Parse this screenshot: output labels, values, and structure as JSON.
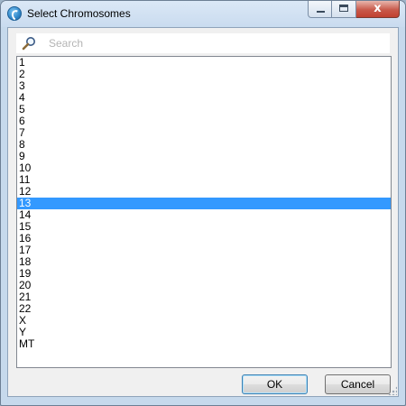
{
  "window": {
    "title": "Select Chromosomes",
    "minimize_glyph": "",
    "maximize_glyph": "",
    "close_glyph": "x"
  },
  "search": {
    "placeholder": "Search",
    "value": ""
  },
  "list": {
    "items": [
      "1",
      "2",
      "3",
      "4",
      "5",
      "6",
      "7",
      "8",
      "9",
      "10",
      "11",
      "12",
      "13",
      "14",
      "15",
      "16",
      "17",
      "18",
      "19",
      "20",
      "21",
      "22",
      "X",
      "Y",
      "MT"
    ],
    "selected": "13"
  },
  "buttons": {
    "ok_label": "OK",
    "cancel_label": "Cancel"
  },
  "colors": {
    "selection": "#3399ff",
    "ok_border": "#3c7fb1"
  },
  "icons": {
    "app": "app-logo-icon",
    "search": "magnifier-icon"
  }
}
